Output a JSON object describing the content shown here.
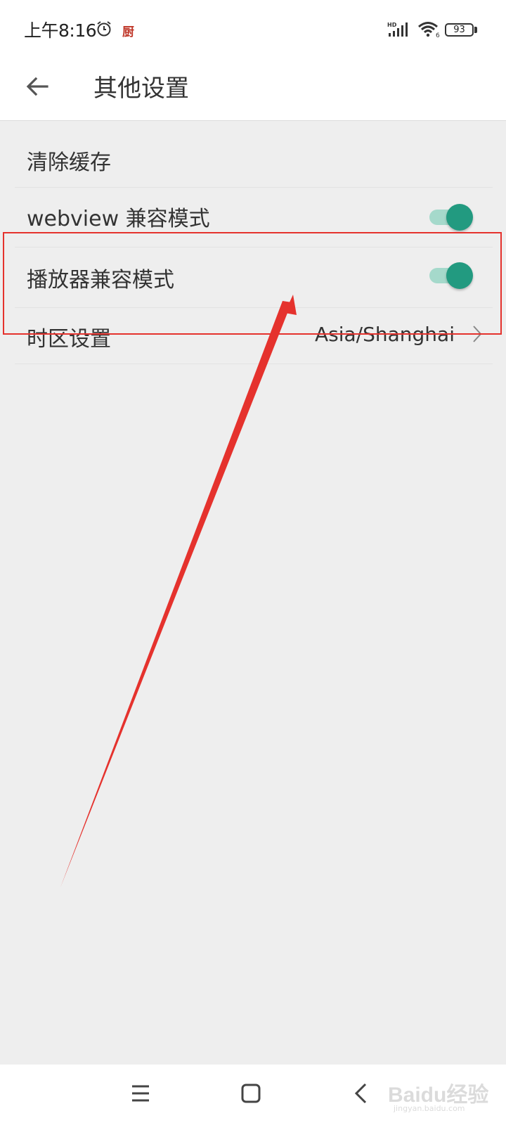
{
  "status_bar": {
    "time": "上午8:16",
    "notification_glyph": "厨",
    "network_label": "HD",
    "wifi_label": "6",
    "battery_level": "93"
  },
  "header": {
    "title": "其他设置",
    "back_icon": "arrow-left-icon"
  },
  "settings": {
    "items": [
      {
        "label": "清除缓存",
        "type": "action"
      },
      {
        "label": "webview 兼容模式",
        "type": "toggle",
        "checked": true
      },
      {
        "label": "播放器兼容模式",
        "type": "toggle",
        "checked": true
      },
      {
        "label": "时区设置",
        "type": "select",
        "value": "Asia/Shanghai"
      }
    ]
  },
  "colors": {
    "accent": "#229a80",
    "accent_track": "#a5d9cb",
    "annotation": "#e5322d",
    "background": "#eeeeee"
  },
  "nav_bar": {
    "icons": [
      "menu-icon",
      "home-icon",
      "back-icon"
    ]
  },
  "watermark": {
    "logo": "Baidu经验",
    "sub": "jingyan.baidu.com"
  }
}
